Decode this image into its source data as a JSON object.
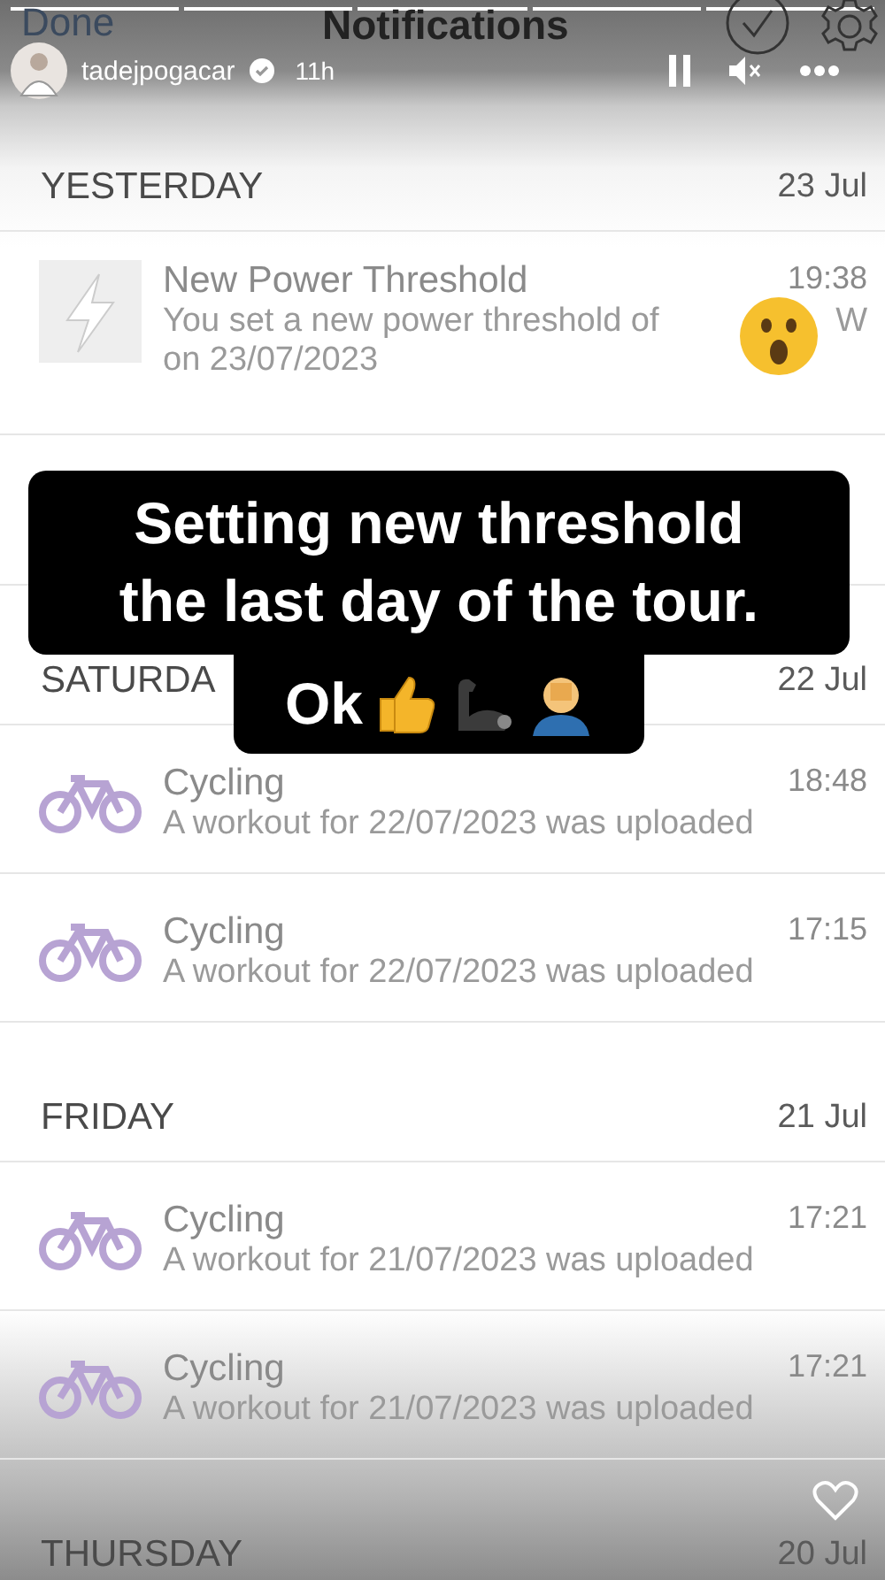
{
  "app_header": {
    "back": "Done",
    "title": "Notifications"
  },
  "story": {
    "username": "tadejpogacar",
    "verified": true,
    "time": "11h"
  },
  "sections": [
    {
      "day": "YESTERDAY",
      "date": "23 Jul",
      "items": [
        {
          "kind": "power",
          "title": "New Power Threshold",
          "time": "19:38",
          "body": "You set a new power threshold of",
          "body_end": "W",
          "body_line2": "on 23/07/2023"
        },
        {
          "kind": "covered"
        }
      ]
    },
    {
      "day": "SATURDA",
      "date": "22 Jul",
      "items": [
        {
          "kind": "cycling",
          "title": "Cycling",
          "time": "18:48",
          "body": "A workout for 22/07/2023 was uploaded"
        },
        {
          "kind": "cycling",
          "title": "Cycling",
          "time": "17:15",
          "body": "A workout for 22/07/2023 was uploaded"
        }
      ]
    },
    {
      "day": "FRIDAY",
      "date": "21 Jul",
      "items": [
        {
          "kind": "cycling",
          "title": "Cycling",
          "time": "17:21",
          "body": "A workout for 21/07/2023 was uploaded"
        },
        {
          "kind": "cycling",
          "title": "Cycling",
          "time": "17:21",
          "body": "A workout for 21/07/2023 was uploaded"
        }
      ]
    },
    {
      "day": "THURSDAY",
      "date": "20 Jul"
    }
  ],
  "caption": {
    "lines": [
      "Setting new threshold",
      "the last day of the tour."
    ],
    "last": "Ok"
  }
}
